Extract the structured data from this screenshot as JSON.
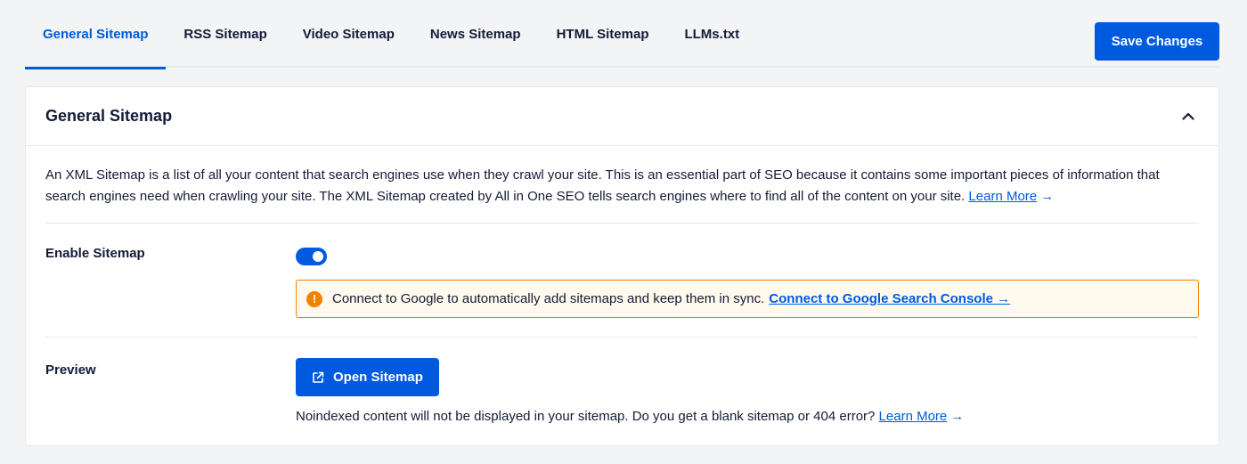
{
  "tabs": [
    {
      "label": "General Sitemap",
      "active": true
    },
    {
      "label": "RSS Sitemap",
      "active": false
    },
    {
      "label": "Video Sitemap",
      "active": false
    },
    {
      "label": "News Sitemap",
      "active": false
    },
    {
      "label": "HTML Sitemap",
      "active": false
    },
    {
      "label": "LLMs.txt",
      "active": false
    }
  ],
  "toolbar": {
    "save_label": "Save Changes"
  },
  "card": {
    "title": "General Sitemap",
    "description": "An XML Sitemap is a list of all your content that search engines use when they crawl your site. This is an essential part of SEO because it contains some important pieces of information that search engines need when crawling your site. The XML Sitemap created by All in One SEO tells search engines where to find all of the content on your site.",
    "learn_more": "Learn More",
    "arrow": "→"
  },
  "enable_sitemap": {
    "label": "Enable Sitemap",
    "enabled": true,
    "alert_text": "Connect to Google to automatically add sitemaps and keep them in sync.",
    "alert_link": "Connect to Google Search Console →",
    "alert_icon": "!"
  },
  "preview": {
    "label": "Preview",
    "button_label": "Open Sitemap",
    "note": "Noindexed content will not be displayed in your sitemap. Do you get a blank sitemap or 404 error?",
    "learn_more": "Learn More",
    "arrow": "→"
  },
  "colors": {
    "accent": "#005ae0",
    "warning": "#f18200",
    "warning_bg": "#fffaed"
  }
}
